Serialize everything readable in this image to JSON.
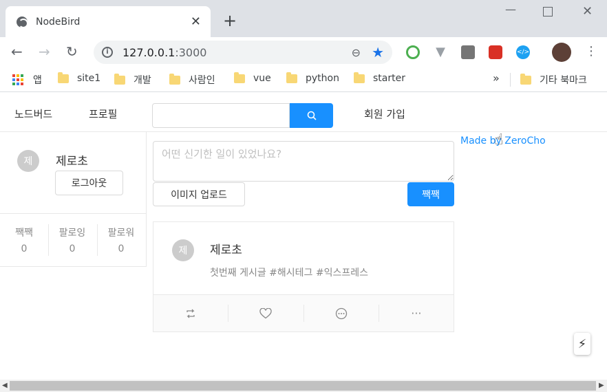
{
  "browser": {
    "tab_title": "NodeBird",
    "tab_close": "✕",
    "new_tab": "+",
    "url_host": "127.0.0.1",
    "url_port": ":3000",
    "bookmarks": [
      {
        "label": "앱",
        "kind": "apps"
      },
      {
        "label": "site1",
        "kind": "folder"
      },
      {
        "label": "개발",
        "kind": "folder"
      },
      {
        "label": "사람인",
        "kind": "folder"
      },
      {
        "label": "vue",
        "kind": "folder"
      },
      {
        "label": "python",
        "kind": "folder"
      },
      {
        "label": "starter",
        "kind": "folder"
      }
    ],
    "more_bookmarks": "»",
    "other_bookmarks": "기타 북마크"
  },
  "nav": {
    "home": "노드버드",
    "profile": "프로필",
    "signup": "회원 가입",
    "search_placeholder": ""
  },
  "user": {
    "avatar_initial": "제",
    "nickname": "제로초",
    "logout": "로그아웃",
    "stats": [
      {
        "label": "짹짹",
        "value": "0"
      },
      {
        "label": "팔로잉",
        "value": "0"
      },
      {
        "label": "팔로워",
        "value": "0"
      }
    ]
  },
  "post_form": {
    "placeholder": "어떤 신기한 일이 있었나요?",
    "upload_label": "이미지 업로드",
    "submit_label": "짹짹"
  },
  "posts": [
    {
      "avatar_initial": "제",
      "author": "제로초",
      "content": "첫번째 게시글 #해시테그 #익스프레스"
    }
  ],
  "sidebar": {
    "made_by": "Made by ZeroCho"
  },
  "colors": {
    "primary": "#1890ff",
    "avatar_bg": "#cccccc",
    "border": "#e8e8e8"
  }
}
